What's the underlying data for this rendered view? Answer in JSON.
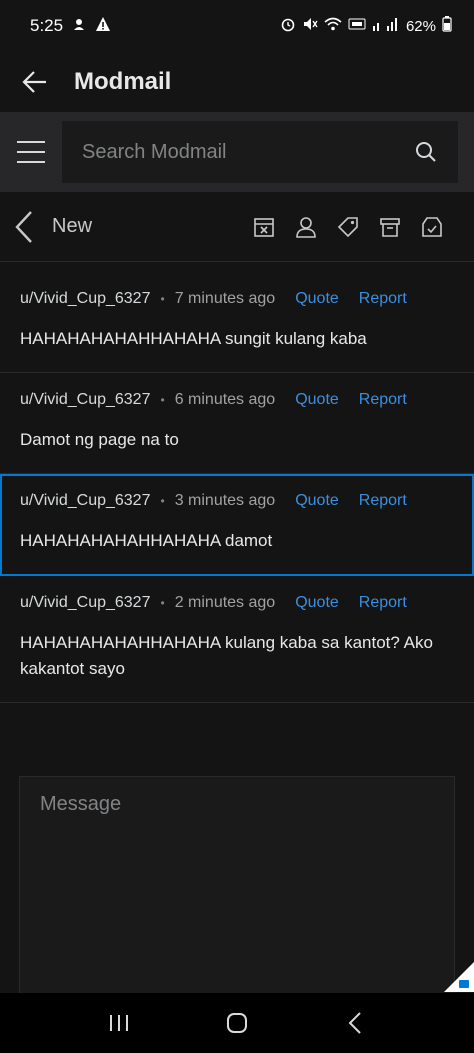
{
  "status_bar": {
    "time": "5:25",
    "battery": "62%"
  },
  "topbar": {
    "title": "Modmail"
  },
  "search": {
    "placeholder": "Search Modmail"
  },
  "conversation": {
    "folder": "New"
  },
  "messages": [
    {
      "author": "u/Vivid_Cup_6327",
      "time": "7 minutes ago",
      "quote_label": "Quote",
      "report_label": "Report",
      "body": "HAHAHAHAHAHHAHAHA sungit kulang kaba"
    },
    {
      "author": "u/Vivid_Cup_6327",
      "time": "6 minutes ago",
      "quote_label": "Quote",
      "report_label": "Report",
      "body": "Damot ng page na to"
    },
    {
      "author": "u/Vivid_Cup_6327",
      "time": "3 minutes ago",
      "quote_label": "Quote",
      "report_label": "Report",
      "body": "HAHAHAHAHAHHAHAHA damot"
    },
    {
      "author": "u/Vivid_Cup_6327",
      "time": "2 minutes ago",
      "quote_label": "Quote",
      "report_label": "Report",
      "body": "HAHAHAHAHAHHAHAHA kulang kaba sa kantot? Ako kakantot sayo"
    }
  ],
  "composer": {
    "placeholder": "Message"
  },
  "colors": {
    "accent": "#0079d3",
    "link": "#3b8ee0",
    "background": "#141414"
  }
}
